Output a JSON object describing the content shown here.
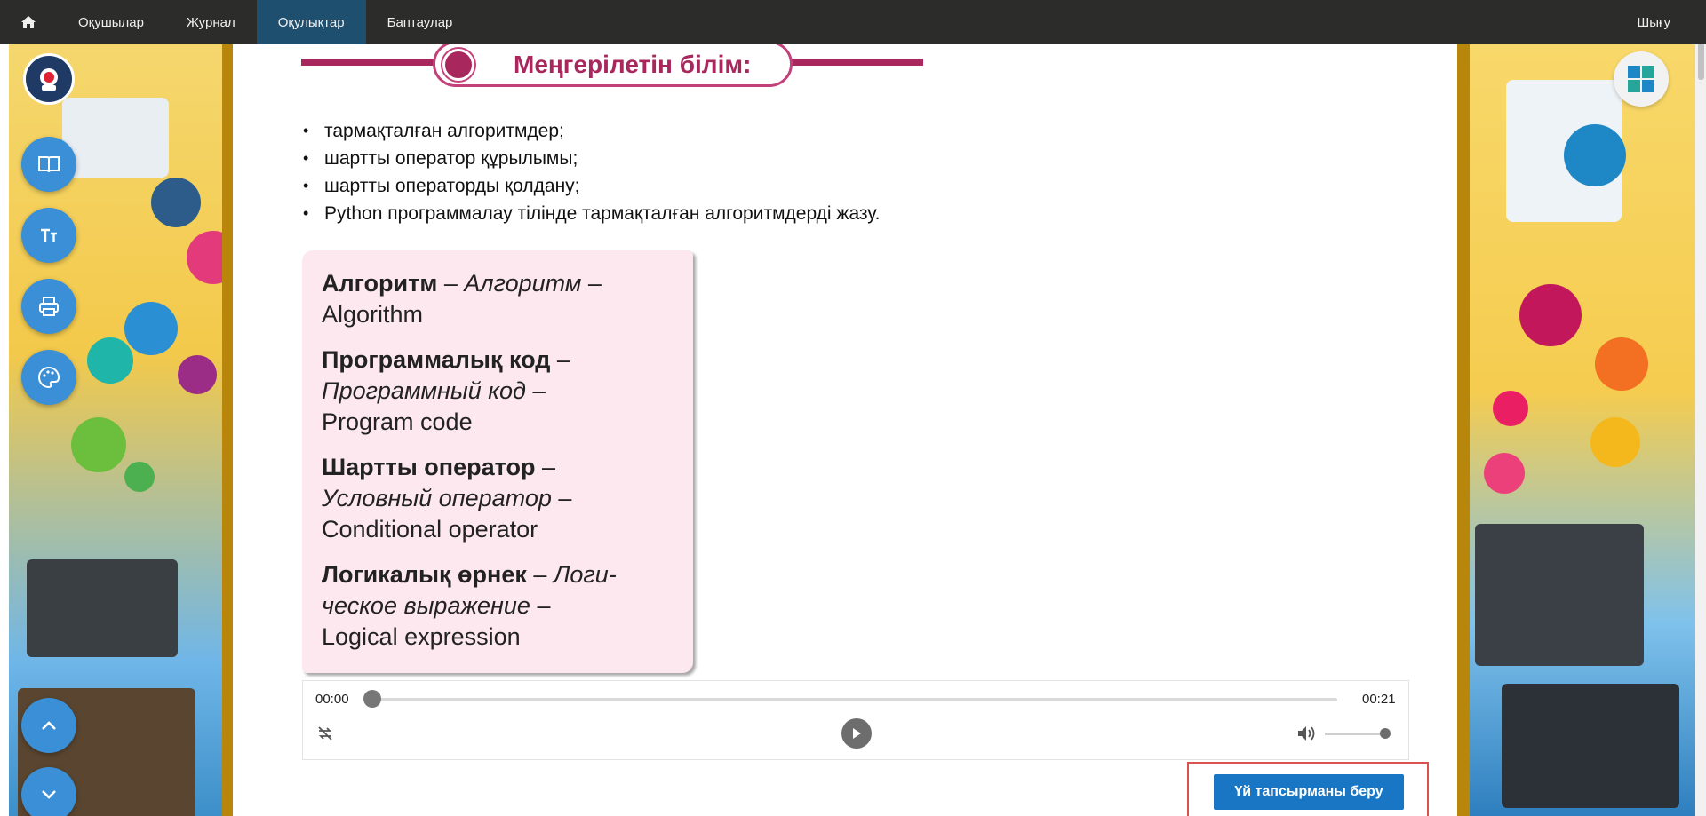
{
  "nav": {
    "items": [
      {
        "label": "Оқушылар",
        "active": false
      },
      {
        "label": "Журнал",
        "active": false
      },
      {
        "label": "Оқулықтар",
        "active": true
      },
      {
        "label": "Баптаулар",
        "active": false
      }
    ],
    "logout": "Шығу"
  },
  "heading": "Меңгерілетін білім:",
  "bullets": [
    "тармақталған алгоритмдер;",
    "шартты оператор құрылымы;",
    "шартты операторды қолдану;",
    "Python программалау тілінде тармақталған алгоритмдерді жазу."
  ],
  "glossary": [
    {
      "kz": "Алгоритм",
      "ru": "Алгоритм",
      "en": "Algorithm"
    },
    {
      "kz": "Программалық код",
      "ru": "Программный код",
      "en": "Program code"
    },
    {
      "kz": "Шартты оператор",
      "ru": "Условный оператор",
      "en": "Conditional operator"
    },
    {
      "kz": "Логикалық өрнек",
      "ru": "Логи-ческое выражение",
      "en": "Logical expression"
    }
  ],
  "player": {
    "current": "00:00",
    "duration": "00:21",
    "progress": 0,
    "volume": 1
  },
  "homework_button": "Үй тапсырманы беру",
  "icons": {
    "home": "home-icon",
    "book": "book-icon",
    "font": "font-size-icon",
    "print": "print-icon",
    "palette": "palette-icon",
    "up": "chevron-up-icon",
    "down": "chevron-down-icon",
    "windows": "windows-icon",
    "repeat": "repeat-icon",
    "play": "play-icon",
    "volume": "volume-icon"
  },
  "colors": {
    "accent": "#a8285e",
    "nav": "#2c2c2a",
    "active": "#1f4f6e",
    "button": "#1976c4",
    "fab": "#3a8fd6"
  }
}
